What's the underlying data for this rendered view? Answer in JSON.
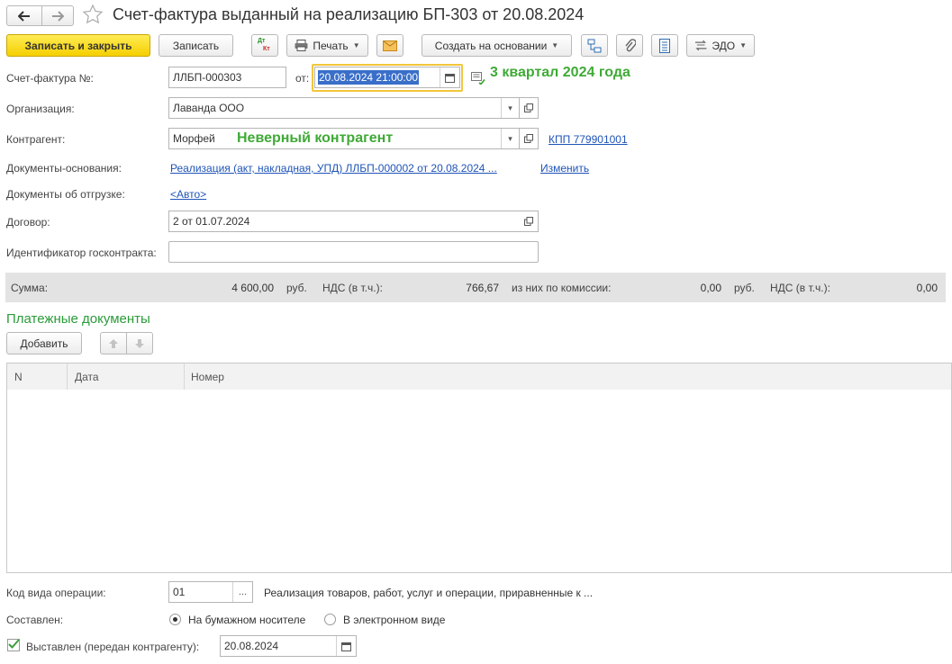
{
  "window": {
    "title": "Счет-фактура выданный на реализацию БП-303 от 20.08.2024"
  },
  "toolbar": {
    "save_close": "Записать и закрыть",
    "save": "Записать",
    "dt_kt_top": "Дт",
    "dt_kt_bottom": "Кт",
    "print": "Печать",
    "create_based": "Создать на основании",
    "edo": "ЭДО"
  },
  "form": {
    "invoice_label": "Счет-фактура №:",
    "invoice_number": "ЛЛБП-000303",
    "date_prefix": "от:",
    "date_value": "20.08.2024 21:00:00",
    "quarter_note": "3 квартал 2024 года",
    "org_label": "Организация:",
    "org_value": "Лаванда ООО",
    "counterparty_label": "Контрагент:",
    "counterparty_value": "Морфей",
    "counterparty_warning": "Неверный контрагент",
    "kpp_link": "КПП 779901001",
    "basis_label": "Документы-основания:",
    "basis_link": "Реализация (акт, накладная, УПД) ЛЛБП-000002 от 20.08.2024 ...",
    "change_link": "Изменить",
    "shipment_label": "Документы об отгрузке:",
    "shipment_link": "<Авто>",
    "contract_label": "Договор:",
    "contract_value": "2 от 01.07.2024",
    "gov_label": "Идентификатор госконтракта:",
    "gov_value": ""
  },
  "summary": {
    "sum_label": "Сумма:",
    "sum_value": "4 600,00",
    "currency1": "руб.",
    "vat_label1": "НДС (в т.ч.):",
    "vat_value1": "766,67",
    "commission_label": "из них по комиссии:",
    "commission_value": "0,00",
    "currency2": "руб.",
    "vat_label2": "НДС (в т.ч.):",
    "vat_value2": "0,00"
  },
  "payments": {
    "title": "Платежные документы",
    "add_button": "Добавить",
    "columns": [
      "N",
      "Дата",
      "Номер"
    ]
  },
  "bottom": {
    "op_code_label": "Код вида операции:",
    "op_code_value": "01",
    "op_code_desc": "Реализация товаров, работ, услуг и операции, приравненные к ...",
    "composed_label": "Составлен:",
    "radio_paper": "На бумажном носителе",
    "radio_electronic": "В электронном виде",
    "issued_label": "Выставлен (передан контрагенту):",
    "issued_date": "20.08.2024"
  },
  "colors": {
    "accent_yellow": "#f5cf00",
    "link_blue": "#1f54b8",
    "green_note": "#3faa36",
    "section_green": "#2b9b3a"
  }
}
